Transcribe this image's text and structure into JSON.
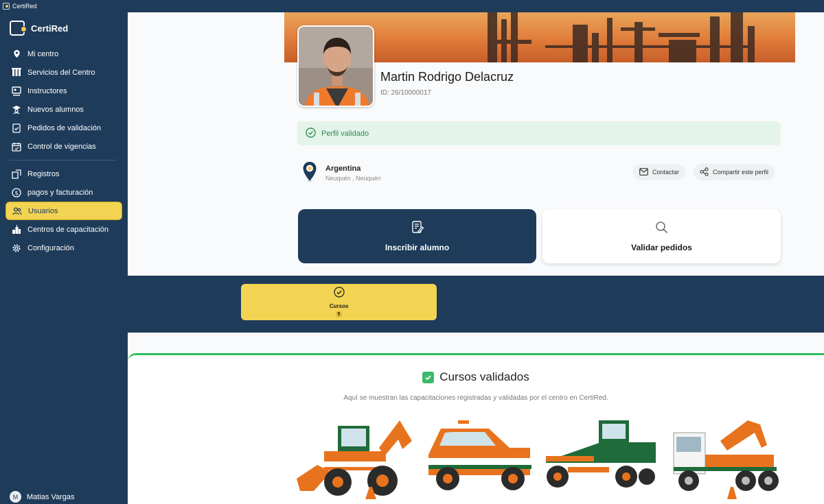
{
  "window": {
    "title": "CertiRed"
  },
  "sidebar": {
    "brand": "CertiRed",
    "items": [
      {
        "label": "Mi centro",
        "icon": "location-pin-icon"
      },
      {
        "label": "Servicios del Centro",
        "icon": "services-icon"
      },
      {
        "label": "Instructores",
        "icon": "instructors-icon"
      },
      {
        "label": "Nuevos alumnos",
        "icon": "new-students-icon"
      },
      {
        "label": "Pedidos de validación",
        "icon": "validation-requests-icon"
      },
      {
        "label": "Control de vigencias",
        "icon": "calendar-check-icon"
      }
    ],
    "items2": [
      {
        "label": "Registros",
        "icon": "records-icon"
      },
      {
        "label": "pagos y facturación",
        "icon": "dollar-icon"
      },
      {
        "label": "Usuarios",
        "icon": "users-icon",
        "active": true
      },
      {
        "label": "Centros de capacitación",
        "icon": "training-centers-icon"
      },
      {
        "label": "Configuración",
        "icon": "gear-icon"
      }
    ],
    "user": {
      "initial": "M",
      "name": "Matias Vargas"
    }
  },
  "profile": {
    "name": "Martin Rodrigo Delacruz",
    "id": "ID: 26/10000017",
    "status": "Perfil validado",
    "country": "Argentina",
    "region": "Neuquén , Neuquén",
    "contact_label": "Contactar",
    "share_label": "Compartir este perfil"
  },
  "actions": {
    "enroll_label": "Inscribir alumno",
    "validate_label": "Validar pedidos"
  },
  "stats": {
    "courses_label": "Cursos",
    "courses_count": "5"
  },
  "courses": {
    "title": "Cursos validados",
    "subtitle": "Aquí se muestran las capacitaciones registradas y validadas por el centro en CertiRed."
  },
  "colors": {
    "navy": "#1e3b5a",
    "yellow": "#f2d352",
    "green": "#2dbe5c"
  }
}
